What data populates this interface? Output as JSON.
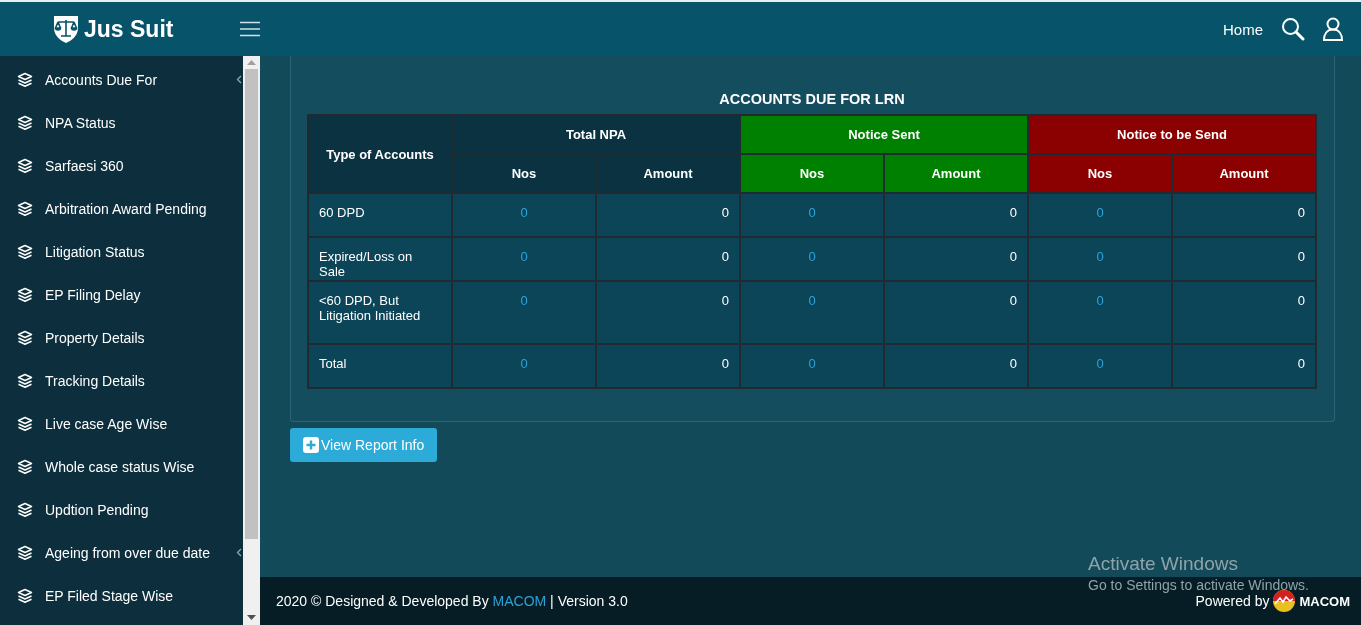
{
  "header": {
    "logo_text": "Jus Suit",
    "nav_link": "Home"
  },
  "sidebar": {
    "items": [
      {
        "label": "Accounts Due For",
        "expandable": true
      },
      {
        "label": "NPA Status",
        "expandable": false
      },
      {
        "label": "Sarfaesi 360",
        "expandable": false
      },
      {
        "label": "Arbitration Award Pending",
        "expandable": false
      },
      {
        "label": "Litigation Status",
        "expandable": false
      },
      {
        "label": "EP Filing Delay",
        "expandable": false
      },
      {
        "label": "Property Details",
        "expandable": false
      },
      {
        "label": "Tracking Details",
        "expandable": false
      },
      {
        "label": "Live case Age Wise",
        "expandable": false
      },
      {
        "label": "Whole case status Wise",
        "expandable": false
      },
      {
        "label": "Updtion Pending",
        "expandable": false
      },
      {
        "label": "Ageing from over due date",
        "expandable": true
      },
      {
        "label": "EP Filed Stage Wise",
        "expandable": false
      }
    ]
  },
  "report": {
    "title": "ACCOUNTS DUE FOR LRN",
    "row_header": "Type of Accounts",
    "groups": [
      {
        "label": "Total NPA",
        "color": "#0b3240",
        "columns": [
          {
            "label": "Nos",
            "kind": "count"
          },
          {
            "label": "Amount",
            "kind": "amount"
          }
        ]
      },
      {
        "label": "Notice Sent",
        "color": "#008000",
        "columns": [
          {
            "label": "Nos",
            "kind": "count"
          },
          {
            "label": "Amount",
            "kind": "amount"
          }
        ]
      },
      {
        "label": "Notice to be Send",
        "color": "#8b0000",
        "columns": [
          {
            "label": "Nos",
            "kind": "count"
          },
          {
            "label": "Amount",
            "kind": "amount"
          }
        ]
      }
    ],
    "rows": [
      {
        "label": "60 DPD",
        "cells": [
          "0",
          "0",
          "0",
          "0",
          "0",
          "0"
        ]
      },
      {
        "label": "Expired/Loss on Sale",
        "cells": [
          "0",
          "0",
          "0",
          "0",
          "0",
          "0"
        ]
      },
      {
        "label": "<60 DPD, But Litigation Initiated",
        "cells": [
          "0",
          "0",
          "0",
          "0",
          "0",
          "0"
        ]
      },
      {
        "label": "Total",
        "cells": [
          "0",
          "0",
          "0",
          "0",
          "0",
          "0"
        ]
      }
    ]
  },
  "view_button": "View Report Info",
  "footer": {
    "credit": "2020 © Designed & Developed By",
    "link": "MACOM",
    "version": "| Version 3.0",
    "powered_by": "Powered by",
    "brand": "MACOM"
  },
  "os_notice": {
    "title": "Activate Windows",
    "text": "Go to Settings to activate Windows."
  }
}
